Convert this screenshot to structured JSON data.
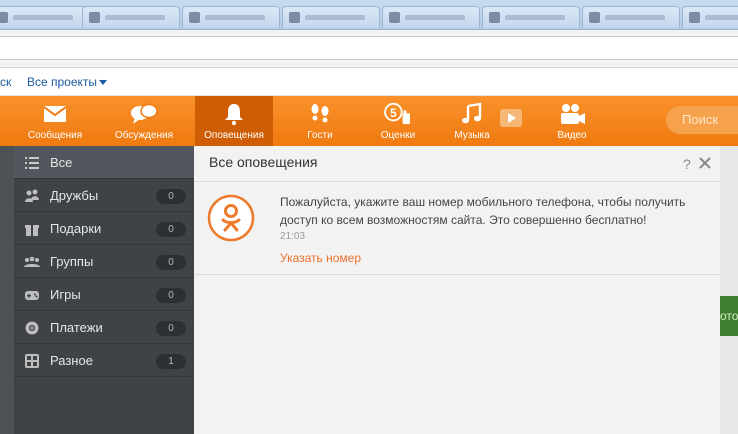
{
  "link_strip": {
    "cut_text": "ск",
    "projects_label": "Все проекты"
  },
  "toolbar": {
    "items": [
      {
        "label": "Сообщения",
        "icon": "envelope-icon"
      },
      {
        "label": "Обсуждения",
        "icon": "speech-bubbles-icon"
      },
      {
        "label": "Оповещения",
        "icon": "bell-icon",
        "active": true
      },
      {
        "label": "Гости",
        "icon": "footprints-icon"
      },
      {
        "label": "Оценки",
        "icon": "five-rating-icon"
      },
      {
        "label": "Музыка",
        "icon": "music-note-icon"
      },
      {
        "label": "Видео",
        "icon": "video-camera-icon"
      }
    ],
    "search_placeholder": "Поиск"
  },
  "sidebar": {
    "items": [
      {
        "label": "Все",
        "icon": "list-icon",
        "active": true
      },
      {
        "label": "Дружбы",
        "icon": "friends-icon",
        "count": "0"
      },
      {
        "label": "Подарки",
        "icon": "gift-icon",
        "count": "0"
      },
      {
        "label": "Группы",
        "icon": "groups-icon",
        "count": "0"
      },
      {
        "label": "Игры",
        "icon": "gamepad-icon",
        "count": "0"
      },
      {
        "label": "Платежи",
        "icon": "payments-icon",
        "count": "0"
      },
      {
        "label": "Разное",
        "icon": "misc-icon",
        "count": "1"
      }
    ]
  },
  "panel": {
    "title": "Все оповещения",
    "help": "?",
    "notification": {
      "icon": "odnoklassniki-logo-icon",
      "text": "Пожалуйста, укажите ваш номер мобильного телефона, чтобы получить доступ ко всем возможностям сайта. Это совершенно бесплатно!",
      "time": "21:03",
      "action_label": "Указать номер"
    }
  },
  "edge": {
    "green_text": "ото"
  },
  "colors": {
    "toolbar_orange": "#f28418",
    "toolbar_active": "#cf5d06",
    "sidebar_dark": "#3f4348",
    "link_orange": "#eb722e",
    "link_blue": "#1a5a9e"
  }
}
